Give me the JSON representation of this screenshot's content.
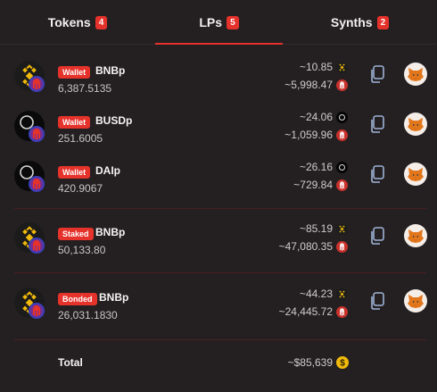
{
  "tabs": [
    {
      "label": "Tokens",
      "count": "4"
    },
    {
      "label": "LPs",
      "count": "5"
    },
    {
      "label": "Synths",
      "count": "2"
    }
  ],
  "active_tab": "LPs",
  "rows": [
    {
      "tag": "Wallet",
      "asset": "BNBp",
      "amount": "6,387.5135",
      "value_a": "~10.85",
      "value_b": "~5,998.47",
      "asset_icon": "bnb-icon",
      "value_a_icon": "bnb-icon"
    },
    {
      "tag": "Wallet",
      "asset": "BUSDp",
      "amount": "251.6005",
      "value_a": "~24.06",
      "value_b": "~1,059.96",
      "asset_icon": "busd-icon",
      "value_a_icon": "busd-icon"
    },
    {
      "tag": "Wallet",
      "asset": "DAIp",
      "amount": "420.9067",
      "value_a": "~26.16",
      "value_b": "~729.84",
      "asset_icon": "dai-icon",
      "value_a_icon": "dai-icon"
    },
    {
      "tag": "Staked",
      "asset": "BNBp",
      "amount": "50,133.80",
      "value_a": "~85.19",
      "value_b": "~47,080.35",
      "asset_icon": "bnb-icon",
      "value_a_icon": "bnb-icon"
    },
    {
      "tag": "Bonded",
      "asset": "BNBp",
      "amount": "26,031.1830",
      "value_a": "~44.23",
      "value_b": "~24,445.72",
      "asset_icon": "bnb-icon",
      "value_a_icon": "bnb-icon"
    }
  ],
  "total": {
    "label": "Total",
    "value": "~$85,639"
  },
  "colors": {
    "accent": "#e5322b",
    "background": "#242022",
    "bnb": "#f0b90b",
    "spartan": "#c8312b",
    "coin": "#f0b90b"
  }
}
